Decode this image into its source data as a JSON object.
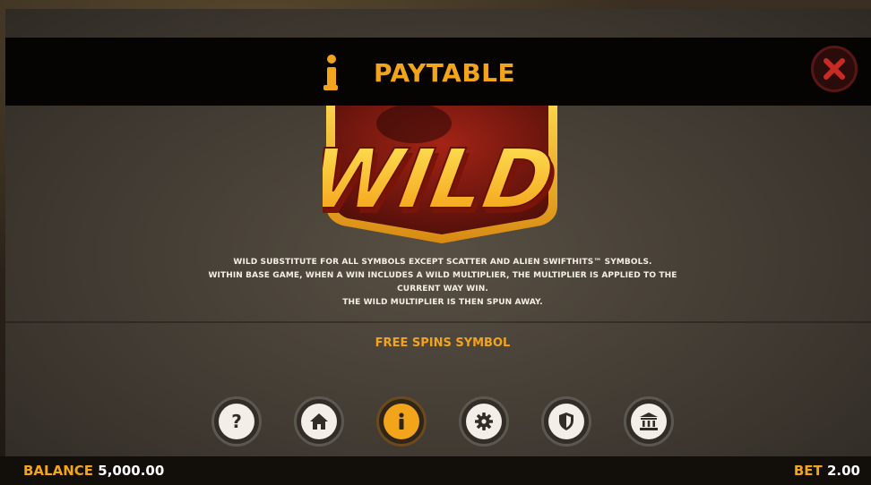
{
  "header": {
    "title": "PAYTABLE",
    "close_icon": "close-icon"
  },
  "symbol": {
    "text": "WILD"
  },
  "description": {
    "lines": [
      "WILD SUBSTITUTE FOR ALL SYMBOLS EXCEPT SCATTER AND ALIEN SWIFTHITS™ SYMBOLS.",
      "WITHIN BASE GAME, WHEN A WIN INCLUDES A WILD MULTIPLIER, THE MULTIPLIER IS APPLIED TO THE",
      "CURRENT WAY WIN.",
      "THE WILD MULTIPLIER IS THEN SPUN AWAY."
    ]
  },
  "next_section": {
    "title": "FREE SPINS SYMBOL"
  },
  "nav": {
    "items": [
      {
        "icon": "question-icon",
        "active": false
      },
      {
        "icon": "home-icon",
        "active": false
      },
      {
        "icon": "info-icon",
        "active": true
      },
      {
        "icon": "gear-icon",
        "active": false
      },
      {
        "icon": "shield-icon",
        "active": false
      },
      {
        "icon": "bank-icon",
        "active": false
      }
    ]
  },
  "footer": {
    "balance_label": "BALANCE",
    "balance_value": "5,000.00",
    "bet_label": "BET",
    "bet_value": "2.00"
  },
  "colors": {
    "accent": "#f2a41a",
    "close_red": "#c82a24",
    "panel": "#474035",
    "header_bg": "#050403"
  }
}
